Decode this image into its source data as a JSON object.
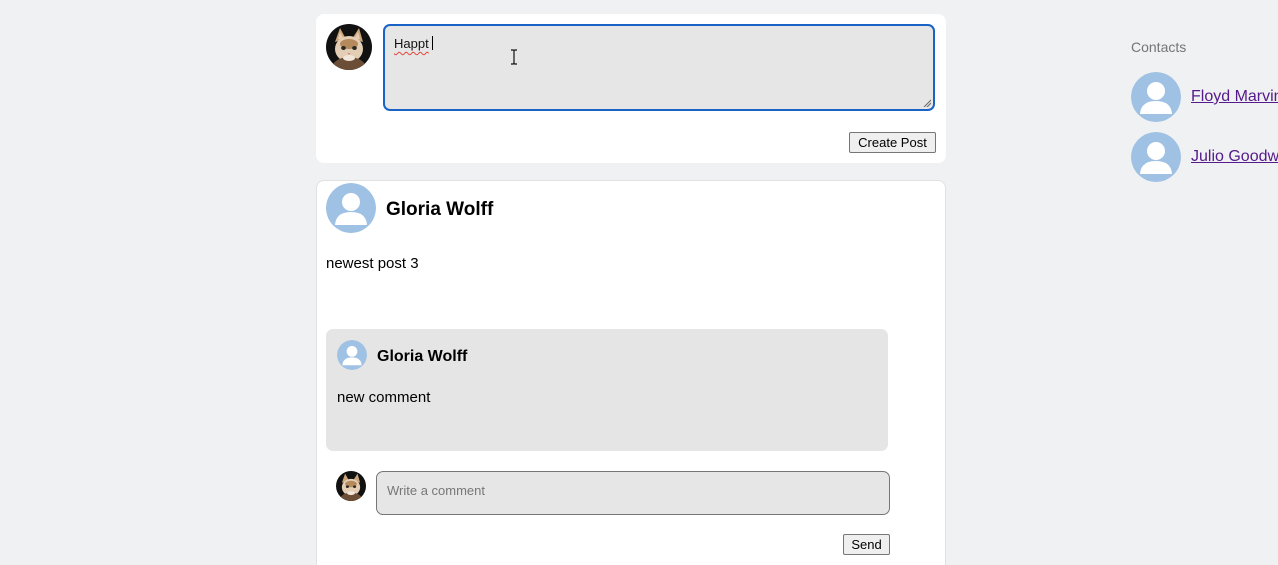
{
  "composer": {
    "text_value": "Happt",
    "create_button_label": "Create Post"
  },
  "post": {
    "author": "Gloria Wolff",
    "body": "newest post 3",
    "comment": {
      "author": "Gloria Wolff",
      "body": "new comment"
    },
    "comment_input_placeholder": "Write a comment",
    "send_button_label": "Send"
  },
  "contacts": {
    "heading": "Contacts",
    "items": [
      {
        "name": "Floyd Marvin"
      },
      {
        "name": "Julio Goodwin"
      }
    ]
  },
  "colors": {
    "page_bg": "#f0f1f3",
    "focus_border": "#1a63c6",
    "link": "#551a8b",
    "default_avatar": "#9fc1e3"
  },
  "icons": {
    "user_avatar": "cat-photo-avatar",
    "default_avatar": "person-silhouette-icon"
  }
}
